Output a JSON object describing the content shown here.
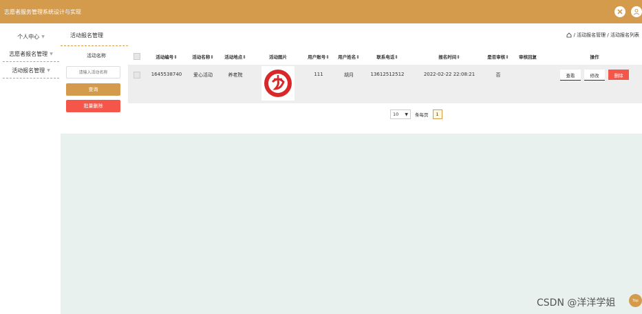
{
  "app": {
    "title": "志愿者服务管理系统设计与实现"
  },
  "sidebar": {
    "items": [
      {
        "label": "个人中心"
      },
      {
        "label": "志愿者报名管理"
      },
      {
        "label": "活动报名管理"
      }
    ]
  },
  "header": {
    "page_title": "活动报名管理",
    "breadcrumb": "/ 活动报名管理 / 活动报名列表"
  },
  "filter": {
    "label": "活动名称",
    "search_placeholder": "请输入活动名称",
    "query_label": "查询",
    "batch_delete_label": "批量删除"
  },
  "table": {
    "columns": [
      "活动编号⇕",
      "活动名称⇕",
      "活动地点⇕",
      "活动图片",
      "用户账号⇕",
      "用户姓名⇕",
      "联系电话⇕",
      "报名时间⇕",
      "是否审核⇕",
      "审核回复",
      "操作"
    ],
    "rows": [
      {
        "activity_no": "1645538740",
        "activity_name": "爱心活动",
        "location": "养老院",
        "account": "111",
        "user_name": "胡月",
        "phone": "13612512512",
        "signup_time": "2022-02-22 22:08:21",
        "reviewed": "否",
        "reply": "",
        "actions": [
          "查看",
          "修改",
          "删除"
        ]
      }
    ]
  },
  "pagination": {
    "page_size": "10",
    "per_page_label": "条每页",
    "current_page": "1"
  },
  "watermark": "CSDN @洋洋学姐",
  "top_button": "Top",
  "colors": {
    "accent": "#d49b4c",
    "danger": "#f4574a",
    "bg_green": "#e8f1ed"
  }
}
